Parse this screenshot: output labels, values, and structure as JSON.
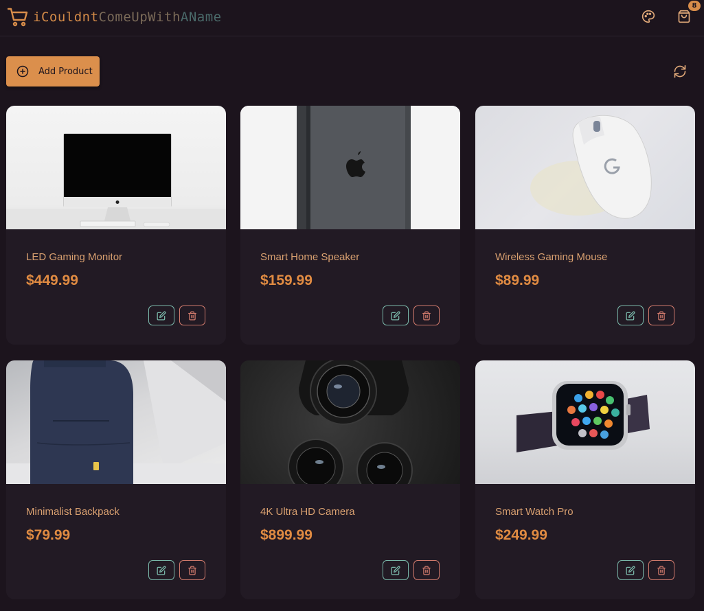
{
  "header": {
    "logo_text_1": "iCouldnt",
    "logo_text_2": "ComeUpWith",
    "logo_text_3": "AName",
    "cart_count": "8",
    "logo_icon": "shopping-cart-icon",
    "palette_icon": "palette-icon",
    "cart_icon": "shopping-bag-icon"
  },
  "toolbar": {
    "add_label": "Add Product",
    "add_icon": "plus-circle-icon",
    "refresh_icon": "refresh-icon"
  },
  "colors": {
    "background": "#1c141d",
    "card": "#221a24",
    "accent": "#db8f4c",
    "price": "#e08b42",
    "title": "#d9a070",
    "edit": "#7ab8aa",
    "delete": "#d07a6c"
  },
  "products": [
    {
      "title": "LED Gaming Monitor",
      "price": "$449.99"
    },
    {
      "title": "Smart Home Speaker",
      "price": "$159.99"
    },
    {
      "title": "Wireless Gaming Mouse",
      "price": "$89.99"
    },
    {
      "title": "Minimalist Backpack",
      "price": "$79.99"
    },
    {
      "title": "4K Ultra HD Camera",
      "price": "$899.99"
    },
    {
      "title": "Smart Watch Pro",
      "price": "$249.99"
    }
  ]
}
